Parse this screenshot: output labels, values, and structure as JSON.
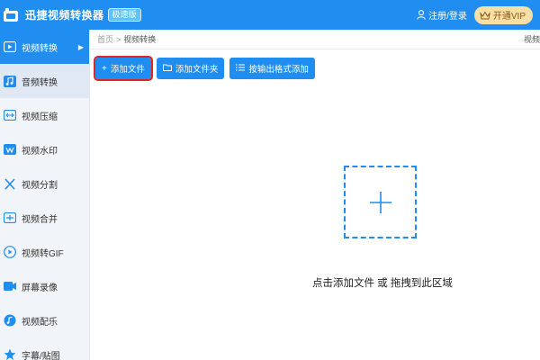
{
  "titlebar": {
    "app_title": "迅捷视频转换器",
    "badge": "极速版",
    "login": "注册/登录",
    "vip": "开通VIP"
  },
  "sidebar": {
    "items": [
      {
        "label": "视频转换",
        "icon": "video-convert-icon"
      },
      {
        "label": "音频转换",
        "icon": "audio-convert-icon"
      },
      {
        "label": "视频压缩",
        "icon": "video-compress-icon"
      },
      {
        "label": "视频水印",
        "icon": "video-watermark-icon"
      },
      {
        "label": "视频分割",
        "icon": "video-split-icon"
      },
      {
        "label": "视频合并",
        "icon": "video-merge-icon"
      },
      {
        "label": "视频转GIF",
        "icon": "video-to-gif-icon"
      },
      {
        "label": "屏幕录像",
        "icon": "screen-record-icon"
      },
      {
        "label": "视频配乐",
        "icon": "video-music-icon"
      },
      {
        "label": "字幕/贴图",
        "icon": "subtitle-sticker-icon"
      }
    ]
  },
  "breadcrumb": {
    "home": "首页",
    "separator": ">",
    "current": "视频转换",
    "right_cut": "视频"
  },
  "toolbar": {
    "add_file": "添加文件",
    "add_folder": "添加文件夹",
    "add_by_format": "按输出格式添加"
  },
  "main": {
    "drop_hint": "点击添加文件 或 拖拽到此区域"
  },
  "colors": {
    "primary": "#1f8ef0",
    "highlight_outline": "#e02323",
    "vip_bg": "#f8dfa6"
  }
}
